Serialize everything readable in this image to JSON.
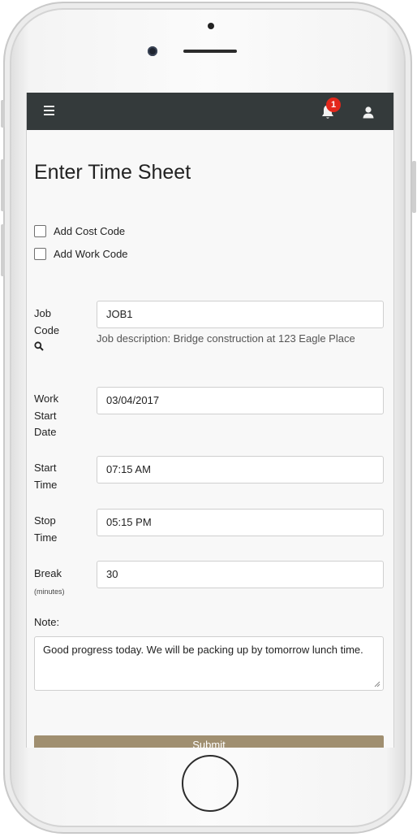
{
  "navbar": {
    "notification_count": "1"
  },
  "page": {
    "title": "Enter Time Sheet"
  },
  "options": {
    "add_cost_code": "Add Cost Code",
    "add_work_code": "Add Work Code"
  },
  "form": {
    "job_code": {
      "label_line1": "Job",
      "label_line2": "Code",
      "value": "JOB1",
      "description": "Job description: Bridge construction at 123 Eagle Place"
    },
    "work_start_date": {
      "label_line1": "Work",
      "label_line2": "Start",
      "label_line3": "Date",
      "value": "03/04/2017"
    },
    "start_time": {
      "label_line1": "Start",
      "label_line2": "Time",
      "value": "07:15 AM"
    },
    "stop_time": {
      "label_line1": "Stop",
      "label_line2": "Time",
      "value": "05:15 PM"
    },
    "break": {
      "label": "Break",
      "unit": "(minutes)",
      "value": "30"
    },
    "note": {
      "label": "Note:",
      "value": "Good progress today. We will be packing up by tomorrow lunch time."
    },
    "submit_label": "Submit"
  },
  "colors": {
    "navbar_bg": "#343a3b",
    "badge": "#e3271b",
    "submit_bg": "#a08f70",
    "screen_bg": "#f8f8f8"
  },
  "icons": {
    "menu": "hamburger-icon",
    "notifications": "bell-icon",
    "account": "user-icon",
    "job_lookup": "search-icon"
  }
}
